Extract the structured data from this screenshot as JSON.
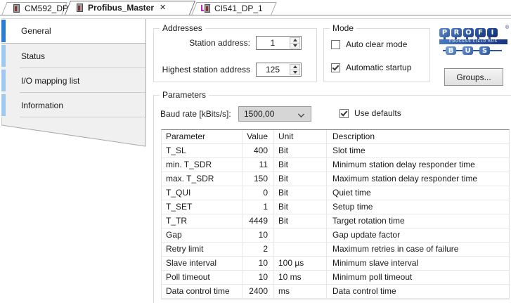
{
  "doc_tabs": [
    {
      "label": "CM592_DP"
    },
    {
      "label": "Profibus_Master",
      "close_label": "✕"
    },
    {
      "label": "CI541_DP_1"
    }
  ],
  "sidebar": {
    "items": [
      {
        "label": "General"
      },
      {
        "label": "Status"
      },
      {
        "label": "I/O mapping list"
      },
      {
        "label": "Information"
      }
    ]
  },
  "addresses": {
    "legend": "Addresses",
    "station_address_label": "Station address:",
    "station_address_value": "1",
    "highest_station_label": "Highest station address",
    "highest_station_value": "125"
  },
  "mode": {
    "legend": "Mode",
    "auto_clear_label": "Auto clear mode",
    "auto_clear_checked": false,
    "auto_startup_label": "Automatic startup",
    "auto_startup_checked": true
  },
  "groups_button_label": "Groups...",
  "profibus_logo": {
    "top_letters": [
      "P",
      "R",
      "O",
      "F",
      "I"
    ],
    "band_text": "PROCESS FIELD BUS",
    "bottom_letters": [
      "B",
      "U",
      "S"
    ],
    "registered_mark": "®"
  },
  "colors": {
    "active_category_accent": "#2b7cd3",
    "inactive_category_accent": "#a0c9ef",
    "logo_blue_dark": "#16357e",
    "logo_blue_light": "#6d9bd6",
    "disabled_combo_bg": "#d6d6d6"
  },
  "parameters": {
    "legend": "Parameters",
    "baud_rate_label": "Baud rate [kBits/s]:",
    "baud_rate_value": "1500,00",
    "use_defaults_label": "Use defaults",
    "use_defaults_checked": true,
    "table": {
      "columns": [
        "Parameter",
        "Value",
        "Unit",
        "Description"
      ],
      "rows": [
        {
          "parameter": "T_SL",
          "value": "400",
          "unit": "Bit",
          "description": "Slot time"
        },
        {
          "parameter": "min. T_SDR",
          "value": "11",
          "unit": "Bit",
          "description": "Minimum station delay responder time"
        },
        {
          "parameter": "max. T_SDR",
          "value": "150",
          "unit": "Bit",
          "description": "Maximum station delay responder time"
        },
        {
          "parameter": "T_QUI",
          "value": "0",
          "unit": "Bit",
          "description": "Quiet time"
        },
        {
          "parameter": "T_SET",
          "value": "1",
          "unit": "Bit",
          "description": "Setup time"
        },
        {
          "parameter": "T_TR",
          "value": "4449",
          "unit": "Bit",
          "description": "Target rotation time"
        },
        {
          "parameter": "Gap",
          "value": "10",
          "unit": "",
          "description": "Gap update factor"
        },
        {
          "parameter": "Retry limit",
          "value": "2",
          "unit": "",
          "description": "Maximum retries in case of failure"
        },
        {
          "parameter": "Slave interval",
          "value": "10",
          "unit": "100 µs",
          "description": "Minimum slave interval"
        },
        {
          "parameter": "Poll timeout",
          "value": "10",
          "unit": "10 ms",
          "description": "Minimum poll timeout"
        },
        {
          "parameter": "Data control time",
          "value": "2400",
          "unit": "ms",
          "description": "Data control time"
        }
      ]
    }
  }
}
